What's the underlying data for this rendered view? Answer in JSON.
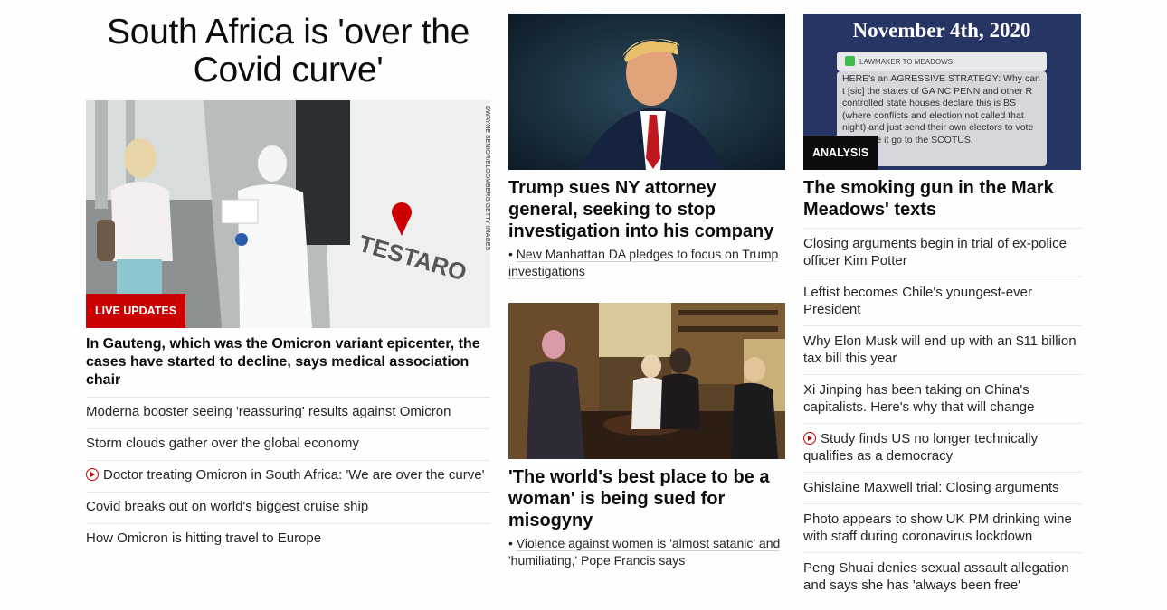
{
  "lead": {
    "title": "South Africa is 'over the Covid curve'",
    "badge": "LIVE UPDATES",
    "photo_credit": "DWAYNE SENIOR/BLOOMBERG/GETTY IMAGES",
    "truck_logo": "TESTARO",
    "headline": "In Gauteng, which was the Omicron variant epicenter, the cases have started to decline, says medical association chair",
    "items": [
      {
        "text": "Moderna booster seeing 'reassuring' results against Omicron",
        "video": false
      },
      {
        "text": "Storm clouds gather over the global economy",
        "video": false
      },
      {
        "text": "Doctor treating Omicron in South Africa: 'We are over the curve'",
        "video": true
      },
      {
        "text": "Covid breaks out on world's biggest cruise ship",
        "video": false
      },
      {
        "text": "How Omicron is hitting travel to Europe",
        "video": false
      }
    ]
  },
  "middle": {
    "story1": {
      "headline": "Trump sues NY attorney general, seeking to stop investigation into his company",
      "sub": "New Manhattan DA pledges to focus on Trump investigations"
    },
    "story2": {
      "headline": "'The world's best place to be a woman' is being sued for misogyny",
      "sub": "Violence against women is 'almost satanic' and 'humiliating,' Pope Francis says"
    }
  },
  "right": {
    "image_date": "November 4th, 2020",
    "image_sender": "LAWMAKER TO MEADOWS",
    "image_message": "HERE's an AGRESSIVE STRATEGY: Why can t [sic] the states of GA NC PENN and other R controlled state houses declare this is BS (where conflicts and election not called that night) and just send their own electors to vote and have it go to the SCOTUS.",
    "badge": "ANALYSIS",
    "headline": "The smoking gun in the Mark Meadows' texts",
    "items": [
      {
        "text": "Closing arguments begin in trial of ex-police officer Kim Potter",
        "video": false
      },
      {
        "text": "Leftist becomes Chile's youngest-ever President",
        "video": false
      },
      {
        "text": "Why Elon Musk will end up with an $11 billion tax bill this year",
        "video": false
      },
      {
        "text": "Xi Jinping has been taking on China's capitalists. Here's why that will change",
        "video": false
      },
      {
        "text": "Study finds US no longer technically qualifies as a democracy",
        "video": true
      },
      {
        "text": "Ghislaine Maxwell trial: Closing arguments",
        "video": false
      },
      {
        "text": "Photo appears to show UK PM drinking wine with staff during coronavirus lockdown",
        "video": false
      },
      {
        "text": "Peng Shuai denies sexual assault allegation and says she has 'always been free'",
        "video": false
      }
    ]
  },
  "colors": {
    "accent_red": "#cc0000",
    "badge_dark": "#0c0c0c",
    "divider": "#e6e6e6"
  }
}
